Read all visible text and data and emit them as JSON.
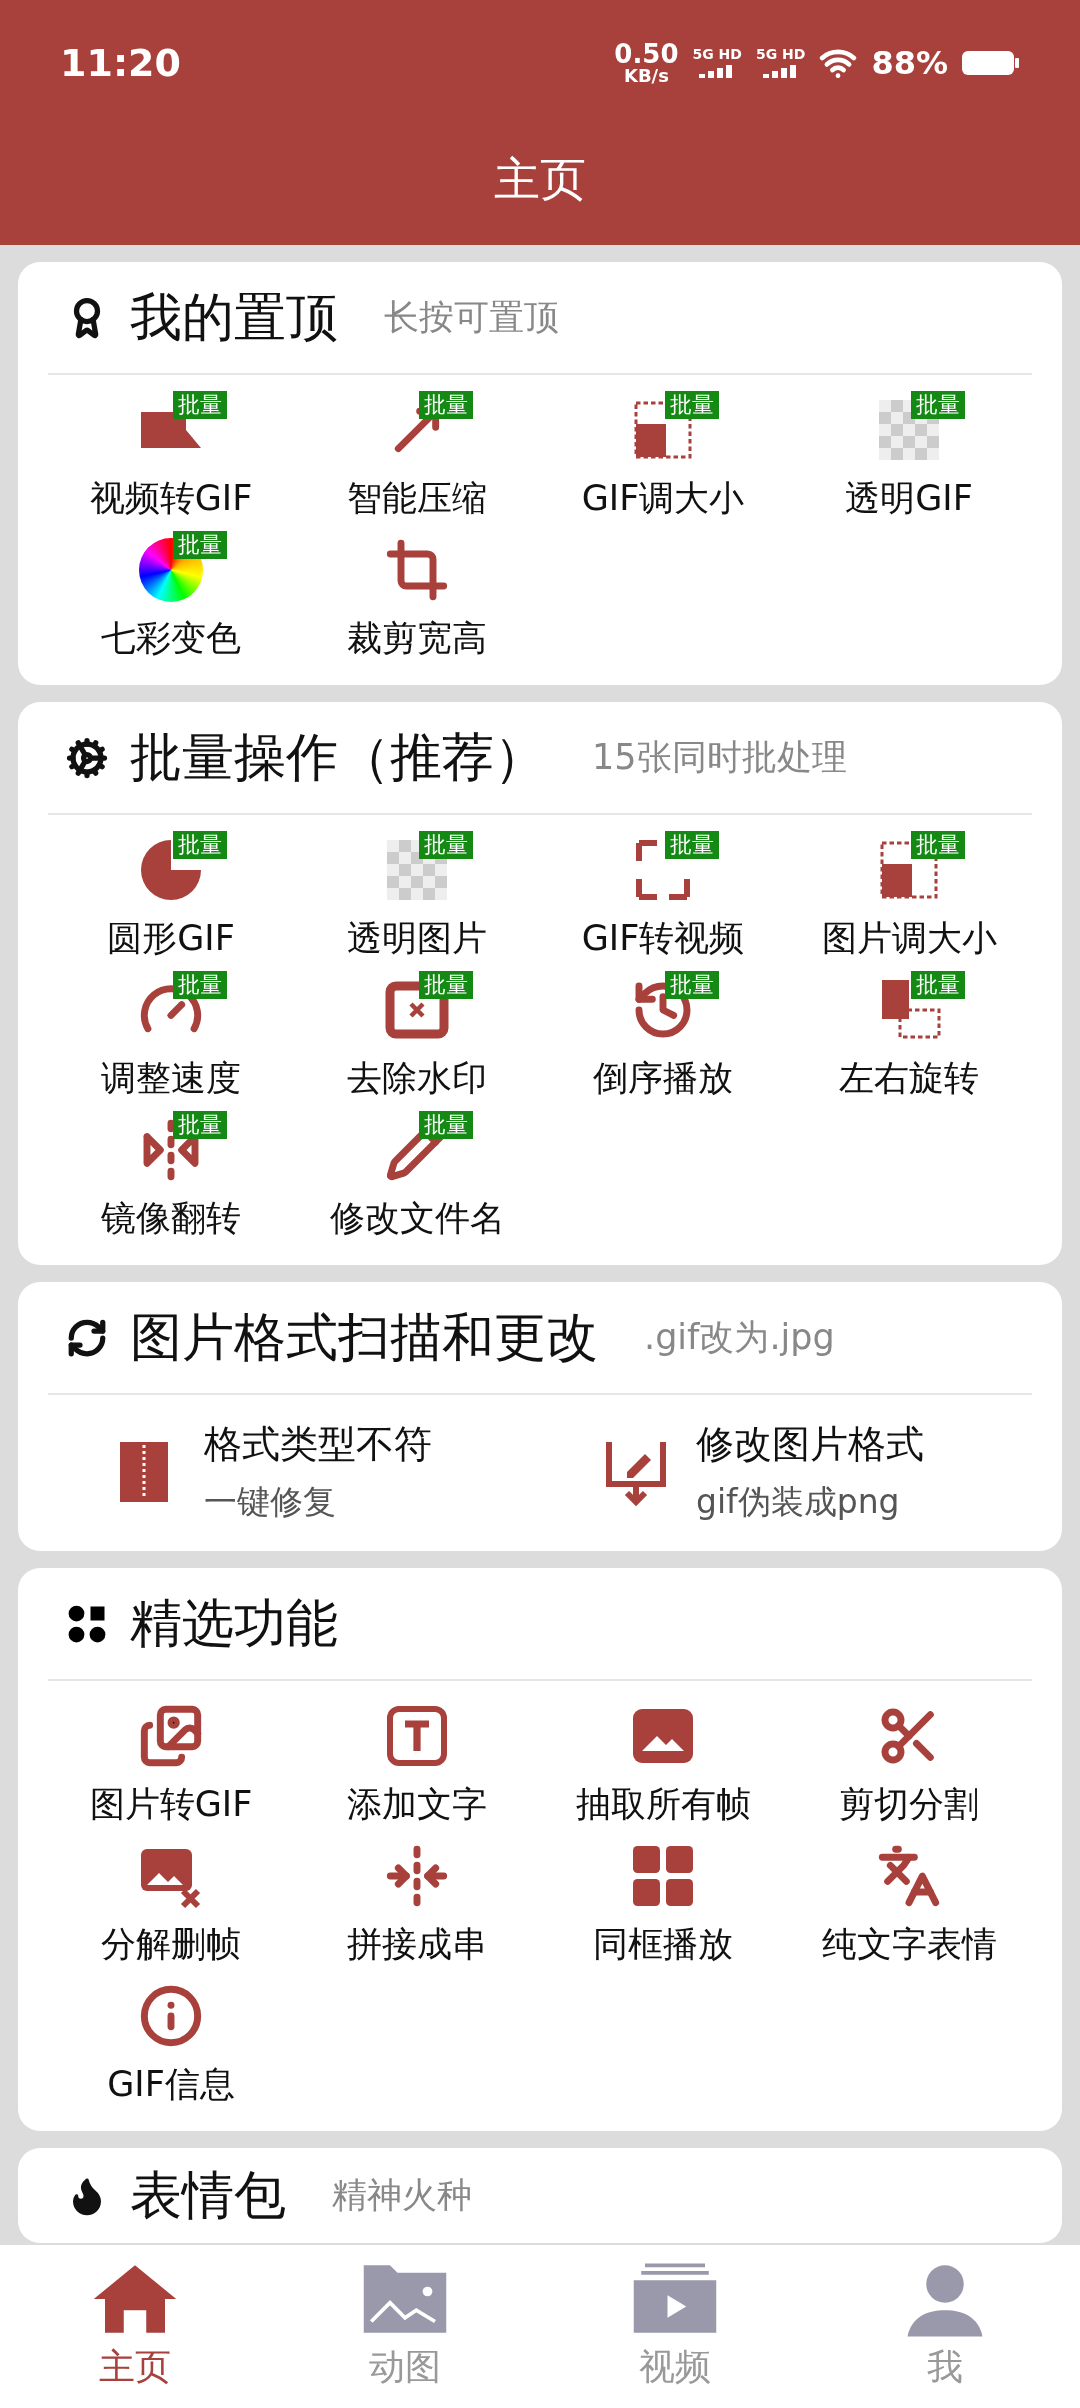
{
  "status_bar": {
    "time": "11:20",
    "net_speed": "0.50",
    "net_unit": "KB/s",
    "sim1": "5G HD",
    "sim2": "5G HD",
    "battery": "88%"
  },
  "header": {
    "title": "主页"
  },
  "sections": [
    {
      "title": "我的置顶",
      "subtitle": "长按可置顶",
      "kind": "grid",
      "items": [
        {
          "label": "视频转GIF",
          "badge": "批量"
        },
        {
          "label": "智能压缩",
          "badge": "批量"
        },
        {
          "label": "GIF调大小",
          "badge": "批量"
        },
        {
          "label": "透明GIF",
          "badge": "批量"
        },
        {
          "label": "七彩变色",
          "badge": "批量"
        },
        {
          "label": "裁剪宽高"
        }
      ]
    },
    {
      "title": "批量操作（推荐）",
      "subtitle": "15张同时批处理",
      "kind": "grid",
      "items": [
        {
          "label": "圆形GIF",
          "badge": "批量"
        },
        {
          "label": "透明图片",
          "badge": "批量"
        },
        {
          "label": "GIF转视频",
          "badge": "批量"
        },
        {
          "label": "图片调大小",
          "badge": "批量"
        },
        {
          "label": "调整速度",
          "badge": "批量"
        },
        {
          "label": "去除水印",
          "badge": "批量"
        },
        {
          "label": "倒序播放",
          "badge": "批量"
        },
        {
          "label": "左右旋转",
          "badge": "批量"
        },
        {
          "label": "镜像翻转",
          "badge": "批量"
        },
        {
          "label": "修改文件名",
          "badge": "批量"
        }
      ]
    },
    {
      "title": "图片格式扫描和更改",
      "subtitle": ".gif改为.jpg",
      "kind": "list",
      "items": [
        {
          "label": "格式类型不符",
          "detail": "一键修复"
        },
        {
          "label": "修改图片格式",
          "detail": "gif伪装成png"
        }
      ]
    },
    {
      "title": "精选功能",
      "kind": "grid",
      "items": [
        {
          "label": "图片转GIF"
        },
        {
          "label": "添加文字"
        },
        {
          "label": "抽取所有帧"
        },
        {
          "label": "剪切分割"
        },
        {
          "label": "分解删帧"
        },
        {
          "label": "拼接成串"
        },
        {
          "label": "同框播放"
        },
        {
          "label": "纯文字表情"
        },
        {
          "label": "GIF信息"
        }
      ]
    },
    {
      "title": "表情包",
      "subtitle": "精神火种",
      "kind": "grid"
    }
  ],
  "nav": [
    {
      "label": "主页",
      "selected": true
    },
    {
      "label": "动图",
      "selected": false
    },
    {
      "label": "视频",
      "selected": false
    },
    {
      "label": "我",
      "selected": false
    }
  ]
}
